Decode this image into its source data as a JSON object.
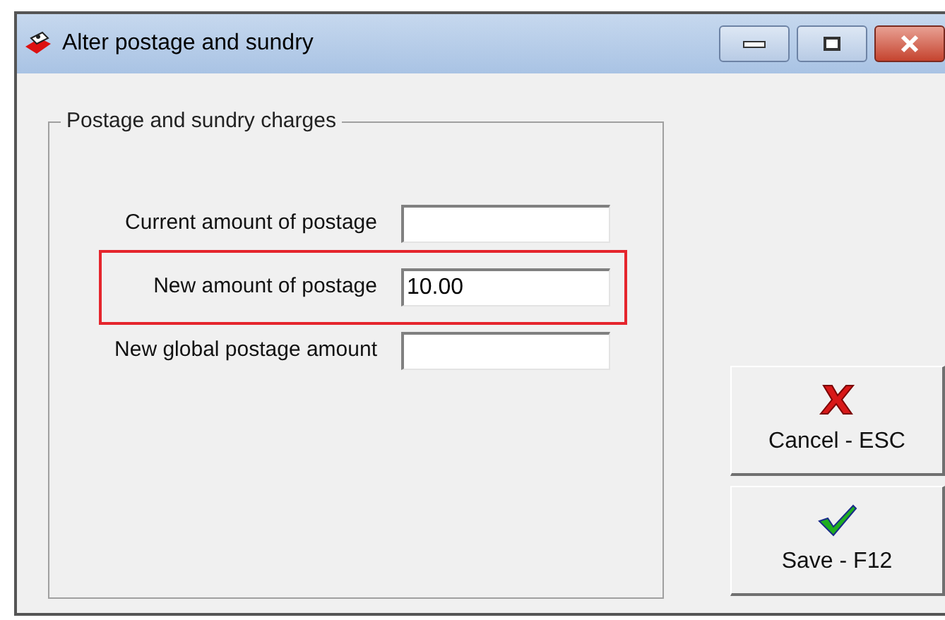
{
  "window": {
    "title": "Alter postage and sundry"
  },
  "group": {
    "title": "Postage and sundry charges",
    "fields": [
      {
        "label": "Current amount of postage",
        "highlighted": false
      },
      {
        "label": "New amount of postage",
        "value": "10.00",
        "highlighted": true
      },
      {
        "label": "New global postage amount",
        "highlighted": false
      }
    ]
  },
  "buttons": [
    {
      "kind": "cancel",
      "label": "Cancel - ESC"
    },
    {
      "kind": "save",
      "label": "Save - F12"
    }
  ]
}
